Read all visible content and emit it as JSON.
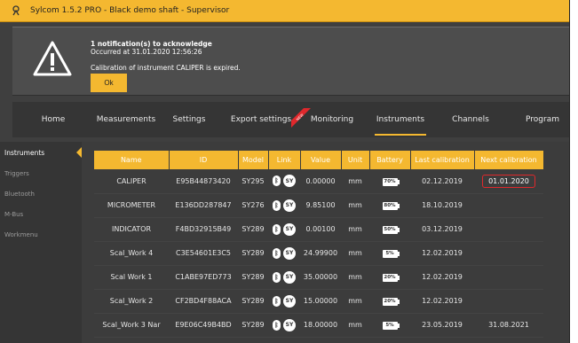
{
  "window": {
    "title": "Sylcom 1.5.2 PRO - Black demo shaft - Supervisor"
  },
  "notification": {
    "title": "1 notification(s) to acknowledge",
    "occurred": "Occurred at 31.01.2020 12:56:26",
    "message": "Calibration of instrument CALIPER is expired.",
    "ok_label": "Ok"
  },
  "nav": {
    "tabs": [
      {
        "label": "Home"
      },
      {
        "label": "Measurements"
      },
      {
        "label": "Settings"
      },
      {
        "label": "Export settings"
      },
      {
        "label": "Monitoring"
      },
      {
        "label": "Instruments"
      },
      {
        "label": "Channels"
      },
      {
        "label": "Program"
      }
    ],
    "active": "Instruments",
    "new_badge": "NEW"
  },
  "sidebar": {
    "items": [
      {
        "label": "Instruments"
      },
      {
        "label": "Triggers"
      },
      {
        "label": "Bluetooth"
      },
      {
        "label": "M-Bus"
      },
      {
        "label": "Workmenu"
      }
    ]
  },
  "table": {
    "headers": [
      "Name",
      "ID",
      "Model",
      "Link",
      "Value",
      "Unit",
      "Battery",
      "Last calibration",
      "Next calibration"
    ],
    "rows": [
      {
        "name": "CALIPER",
        "id": "E95B44873420",
        "model": "SY295",
        "link": "SY",
        "value": "0.00000",
        "unit": "mm",
        "battery": "70%",
        "last_cal": "02.12.2019",
        "next_cal": "01.01.2020"
      },
      {
        "name": "MICROMETER",
        "id": "E136DD287847",
        "model": "SY276",
        "link": "SY",
        "value": "9.85100",
        "unit": "mm",
        "battery": "80%",
        "last_cal": "18.10.2019",
        "next_cal": ""
      },
      {
        "name": "INDICATOR",
        "id": "F4BD32915B49",
        "model": "SY289",
        "link": "SY",
        "value": "0.00100",
        "unit": "mm",
        "battery": "50%",
        "last_cal": "03.12.2019",
        "next_cal": ""
      },
      {
        "name": "Scal_Work 4",
        "id": "C3E54601E3C5",
        "model": "SY289",
        "link": "SY",
        "value": "24.99900",
        "unit": "mm",
        "battery": "5%",
        "last_cal": "12.02.2019",
        "next_cal": ""
      },
      {
        "name": "Scal Work 1",
        "id": "C1ABE97ED773",
        "model": "SY289",
        "link": "SY",
        "value": "35.00000",
        "unit": "mm",
        "battery": "20%",
        "last_cal": "12.02.2019",
        "next_cal": ""
      },
      {
        "name": "Scal_Work 2",
        "id": "CF2BD4F88ACA",
        "model": "SY289",
        "link": "SY",
        "value": "15.00000",
        "unit": "mm",
        "battery": "20%",
        "last_cal": "12.02.2019",
        "next_cal": ""
      },
      {
        "name": "Scal_Work 3 Nar",
        "id": "E9E06C49B4BD",
        "model": "SY289",
        "link": "SY",
        "value": "18.00000",
        "unit": "mm",
        "battery": "5%",
        "last_cal": "23.05.2019",
        "next_cal": "31.08.2021"
      }
    ]
  },
  "colors": {
    "accent": "#f4b830",
    "background": "#3f3f3f",
    "alert": "#e0282c"
  }
}
